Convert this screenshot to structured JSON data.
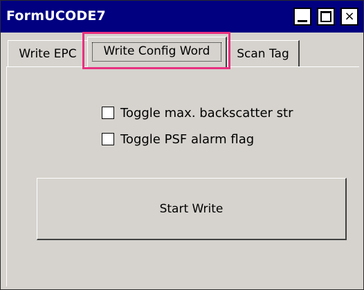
{
  "window": {
    "title": "FormUCODE7",
    "controls": {
      "minimize_icon": "minimize-icon",
      "maximize_icon": "maximize-icon",
      "close_icon": "close-icon",
      "close_glyph": "×"
    }
  },
  "tabs": [
    {
      "label": "Write EPC",
      "selected": false
    },
    {
      "label": "Write Config Word",
      "selected": true
    },
    {
      "label": "Scan Tag",
      "selected": false
    }
  ],
  "options": {
    "checkboxes": [
      {
        "label": "Toggle max. backscatter str",
        "checked": false
      },
      {
        "label": "Toggle PSF alarm flag",
        "checked": false
      }
    ]
  },
  "actions": {
    "start_label": "Start Write"
  },
  "colors": {
    "titlebar": "#000080",
    "face": "#d6d3ce",
    "highlight": "#e8307f"
  }
}
